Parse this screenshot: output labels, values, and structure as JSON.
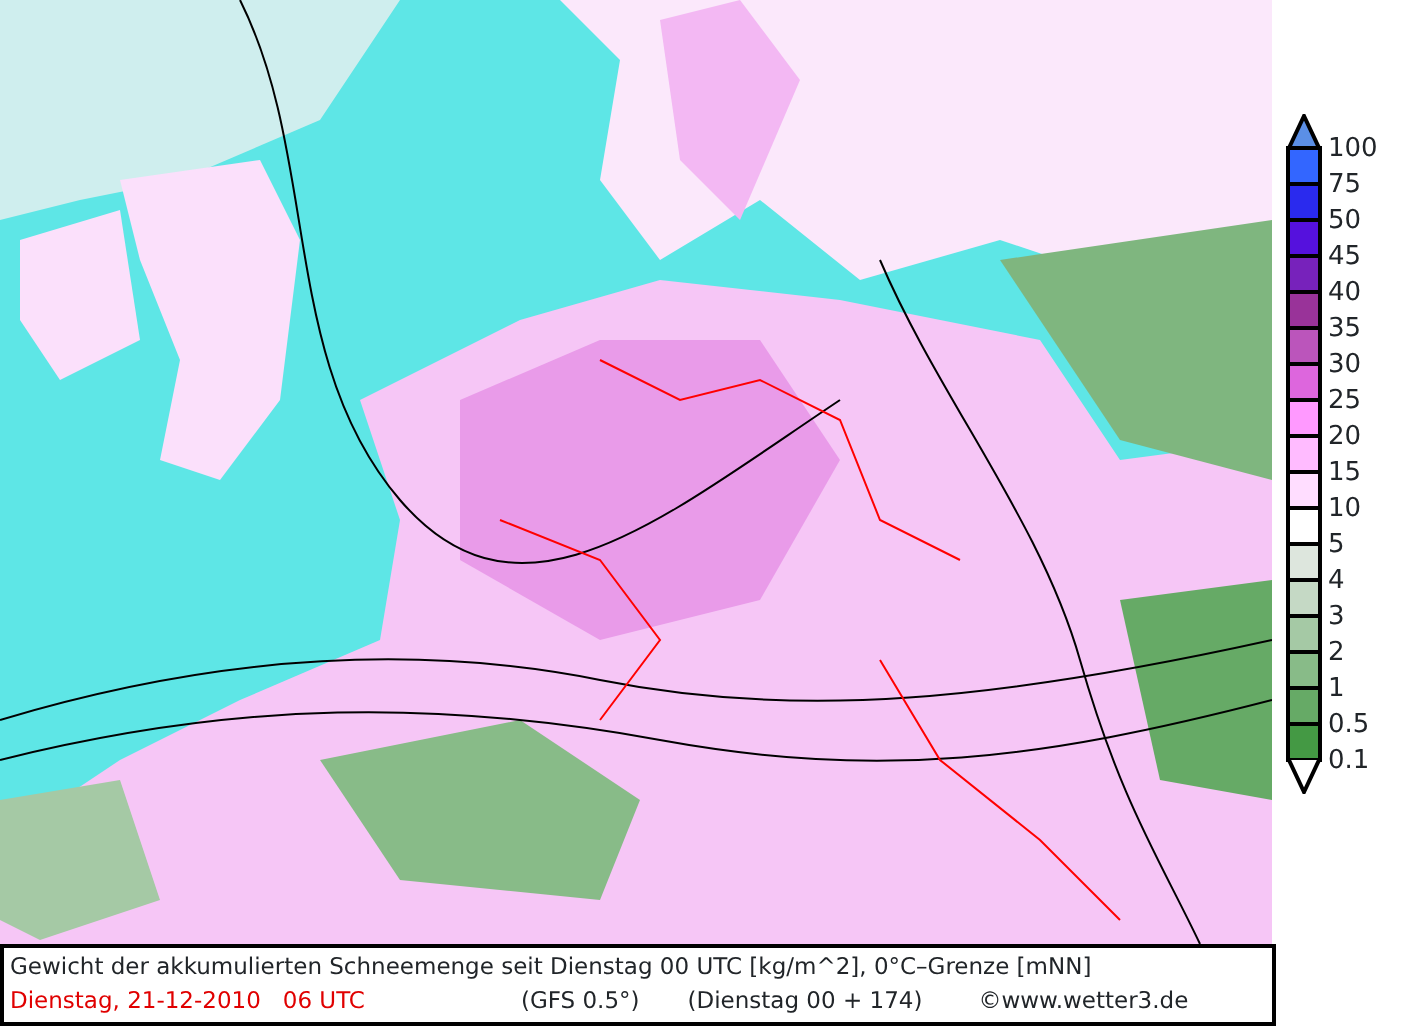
{
  "legend": {
    "bins": [
      {
        "kind": "arrow-up",
        "color": "#5b8fe6"
      },
      {
        "kind": "box",
        "color": "#3366ff"
      },
      {
        "kind": "box",
        "color": "#2a2aee"
      },
      {
        "kind": "box",
        "color": "#5511dd"
      },
      {
        "kind": "box",
        "color": "#7722bb"
      },
      {
        "kind": "box",
        "color": "#993399"
      },
      {
        "kind": "box",
        "color": "#bb55bb"
      },
      {
        "kind": "box",
        "color": "#dd66dd"
      },
      {
        "kind": "box",
        "color": "#ff99ff"
      },
      {
        "kind": "box",
        "color": "#ffbbff"
      },
      {
        "kind": "box",
        "color": "#ffddff"
      },
      {
        "kind": "box",
        "color": "#ffffff"
      },
      {
        "kind": "box",
        "color": "#dde6dd"
      },
      {
        "kind": "box",
        "color": "#c5d9c5"
      },
      {
        "kind": "box",
        "color": "#a5c9a5"
      },
      {
        "kind": "box",
        "color": "#88bb88"
      },
      {
        "kind": "box",
        "color": "#66aa66"
      },
      {
        "kind": "box",
        "color": "#449944"
      },
      {
        "kind": "arrow-down"
      }
    ],
    "labels": [
      "100",
      "75",
      "50",
      "45",
      "40",
      "35",
      "30",
      "25",
      "20",
      "15",
      "10",
      "5",
      "4",
      "3",
      "2",
      "1",
      "0.5",
      "0.1"
    ]
  },
  "caption": {
    "title": "Gewicht der akkumulierten Schneemenge seit Dienstag 00 UTC [kg/m^2], 0°C–Grenze [mNN]",
    "valid_time": "Dienstag, 21-12-2010   06 UTC",
    "model": "(GFS 0.5°)",
    "forecast_step": "(Dienstag 00 + 174)",
    "copyright_symbol": "©",
    "source": "www.wetter3.de"
  }
}
